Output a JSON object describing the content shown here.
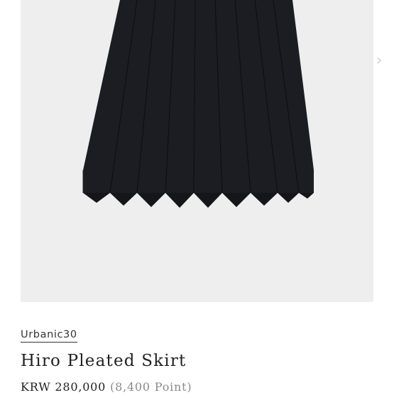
{
  "product": {
    "brand": "Urbanic30",
    "name": "Hiro Pleated Skirt",
    "price": "KRW 280,000",
    "points": "(8,400 Point)"
  },
  "gallery": {
    "next_icon": "chevron-right-icon",
    "background_color": "#eeeeee"
  },
  "colors": {
    "skirt": "#1b1c21",
    "text": "#222222",
    "muted": "#8a8a8a"
  }
}
